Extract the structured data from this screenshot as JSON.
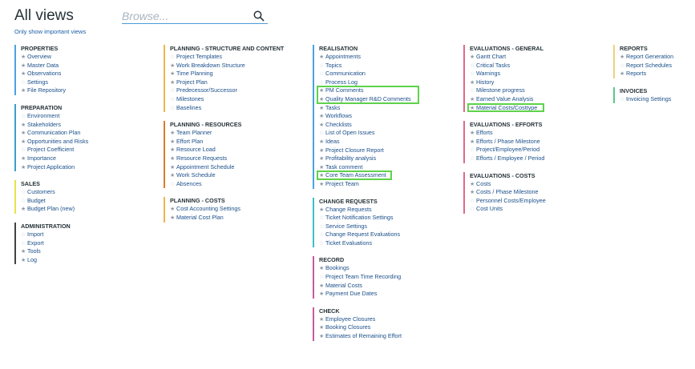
{
  "header": {
    "title": "All views",
    "filter_link": "Only show important views",
    "search_placeholder": "Browse..."
  },
  "colors": {
    "properties": "#4aa3df",
    "preparation": "#3aa0c8",
    "sales": "#e8e24a",
    "administration": "#444444",
    "planning_structure": "#f0b44a",
    "planning_resources": "#e07a2a",
    "planning_costs": "#f0b44a",
    "realisation": "#4aa3df",
    "change_requests": "#3ac0c8",
    "record": "#c65aa0",
    "check": "#c65aa0",
    "evaluations": "#e06a86",
    "reports": "#f0d080",
    "invoices": "#5ac88a",
    "highlight": "#5ed24b"
  },
  "columns": [
    {
      "groups": [
        {
          "key": "properties",
          "title": "PROPERTIES",
          "items": [
            {
              "label": "Overview",
              "star": true
            },
            {
              "label": "Master Data",
              "star": true
            },
            {
              "label": "Observations",
              "star": true
            },
            {
              "label": "Settings",
              "star": false
            },
            {
              "label": "File Repository",
              "star": true
            }
          ]
        },
        {
          "key": "preparation",
          "title": "PREPARATION",
          "items": [
            {
              "label": "Environment",
              "star": false
            },
            {
              "label": "Stakeholders",
              "star": true
            },
            {
              "label": "Communication Plan",
              "star": true
            },
            {
              "label": "Opportunities and Risks",
              "star": true
            },
            {
              "label": "Project Coefficient",
              "star": false
            },
            {
              "label": "Importance",
              "star": true
            },
            {
              "label": "Project Application",
              "star": true
            }
          ]
        },
        {
          "key": "sales",
          "title": "SALES",
          "items": [
            {
              "label": "Customers",
              "star": false
            },
            {
              "label": "Budget",
              "star": false
            },
            {
              "label": "Budget Plan (new)",
              "star": true
            }
          ]
        },
        {
          "key": "administration",
          "title": "ADMINISTRATION",
          "items": [
            {
              "label": "Import",
              "star": false
            },
            {
              "label": "Export",
              "star": false
            },
            {
              "label": "Tools",
              "star": true
            },
            {
              "label": "Log",
              "star": true
            }
          ]
        }
      ]
    },
    {
      "groups": [
        {
          "key": "planning_structure",
          "title": "PLANNING - STRUCTURE AND CONTENT",
          "items": [
            {
              "label": "Project Templates",
              "star": false
            },
            {
              "label": "Work Breakdown Structure",
              "star": true
            },
            {
              "label": "Time Planning",
              "star": true
            },
            {
              "label": "Project Plan",
              "star": true
            },
            {
              "label": "Predecessor/Successor",
              "star": false
            },
            {
              "label": "Milestones",
              "star": false
            },
            {
              "label": "Baselines",
              "star": false
            }
          ]
        },
        {
          "key": "planning_resources",
          "title": "PLANNING - RESOURCES",
          "items": [
            {
              "label": "Team Planner",
              "star": true
            },
            {
              "label": "Effort Plan",
              "star": true
            },
            {
              "label": "Resource Load",
              "star": true
            },
            {
              "label": "Resource Requests",
              "star": true
            },
            {
              "label": "Appointment Schedule",
              "star": true
            },
            {
              "label": "Work Schedule",
              "star": true
            },
            {
              "label": "Absences",
              "star": false
            }
          ]
        },
        {
          "key": "planning_costs",
          "title": "PLANNING - COSTS",
          "items": [
            {
              "label": "Cost Accounting Settings",
              "star": true
            },
            {
              "label": "Material Cost Plan",
              "star": true
            }
          ]
        }
      ]
    },
    {
      "groups": [
        {
          "key": "realisation",
          "title": "REALISATION",
          "items": [
            {
              "label": "Appointments",
              "star": true
            },
            {
              "label": "Topics",
              "star": false
            },
            {
              "label": "Communication",
              "star": false
            },
            {
              "label": "Process Log",
              "star": false
            },
            {
              "label": "PM Comments",
              "star": true,
              "highlight": "hl-a"
            },
            {
              "label": "Quality Manager R&D Comments",
              "star": true,
              "highlight": "hl-a"
            },
            {
              "label": "Tasks",
              "star": true
            },
            {
              "label": "Workflows",
              "star": true
            },
            {
              "label": "Checklists",
              "star": true
            },
            {
              "label": "List of Open Issues",
              "star": false
            },
            {
              "label": "Ideas",
              "star": true
            },
            {
              "label": "Project Closure Report",
              "star": true
            },
            {
              "label": "Profitability analysis",
              "star": true
            },
            {
              "label": "Task comment",
              "star": true
            },
            {
              "label": "Core Team Assessment",
              "star": true,
              "highlight": "hl-b"
            },
            {
              "label": "Project Team",
              "star": true
            }
          ]
        },
        {
          "key": "change_requests",
          "title": "CHANGE REQUESTS",
          "items": [
            {
              "label": "Change Requests",
              "star": true
            },
            {
              "label": "Ticket Notification Settings",
              "star": false
            },
            {
              "label": "Service Settings",
              "star": false
            },
            {
              "label": "Change Request Evaluations",
              "star": false
            },
            {
              "label": "Ticket Evaluations",
              "star": false
            }
          ]
        },
        {
          "key": "record",
          "title": "RECORD",
          "items": [
            {
              "label": "Bookings",
              "star": true
            },
            {
              "label": "Project Team Time Recording",
              "star": false
            },
            {
              "label": "Material Costs",
              "star": true
            },
            {
              "label": "Payment Due Dates",
              "star": true
            }
          ]
        },
        {
          "key": "check",
          "title": "CHECK",
          "items": [
            {
              "label": "Employee Closures",
              "star": true
            },
            {
              "label": "Booking Closures",
              "star": true
            },
            {
              "label": "Estimates of Remaining Effort",
              "star": true
            }
          ]
        }
      ]
    },
    {
      "groups": [
        {
          "key": "evaluations",
          "title": "EVALUATIONS - GENERAL",
          "items": [
            {
              "label": "Gantt Chart",
              "star": true
            },
            {
              "label": "Critical Tasks",
              "star": false
            },
            {
              "label": "Warnings",
              "star": false
            },
            {
              "label": "History",
              "star": true
            },
            {
              "label": "Milestone progress",
              "star": false
            },
            {
              "label": "Earned Value Analysis",
              "star": true
            },
            {
              "label": "Material Costs/Costtype",
              "star": true,
              "highlight": "hl-c"
            }
          ]
        },
        {
          "key": "evaluations",
          "title": "EVALUATIONS - EFFORTS",
          "items": [
            {
              "label": "Efforts",
              "star": true
            },
            {
              "label": "Efforts / Phase Milestone",
              "star": true
            },
            {
              "label": "Project/Employee/Period",
              "star": false
            },
            {
              "label": "Efforts / Employee / Period",
              "star": false
            }
          ]
        },
        {
          "key": "evaluations",
          "title": "EVALUATIONS - COSTS",
          "items": [
            {
              "label": "Costs",
              "star": true
            },
            {
              "label": "Costs / Phase Milestone",
              "star": true
            },
            {
              "label": "Personnel Costs/Employee",
              "star": false
            },
            {
              "label": "Cost Units",
              "star": false
            }
          ]
        }
      ]
    },
    {
      "groups": [
        {
          "key": "reports",
          "title": "REPORTS",
          "items": [
            {
              "label": "Report Generation",
              "star": true
            },
            {
              "label": "Report Schedules",
              "star": false
            },
            {
              "label": "Reports",
              "star": true
            }
          ]
        },
        {
          "key": "invoices",
          "title": "INVOICES",
          "items": [
            {
              "label": "Invoicing Settings",
              "star": false
            }
          ]
        }
      ]
    }
  ]
}
